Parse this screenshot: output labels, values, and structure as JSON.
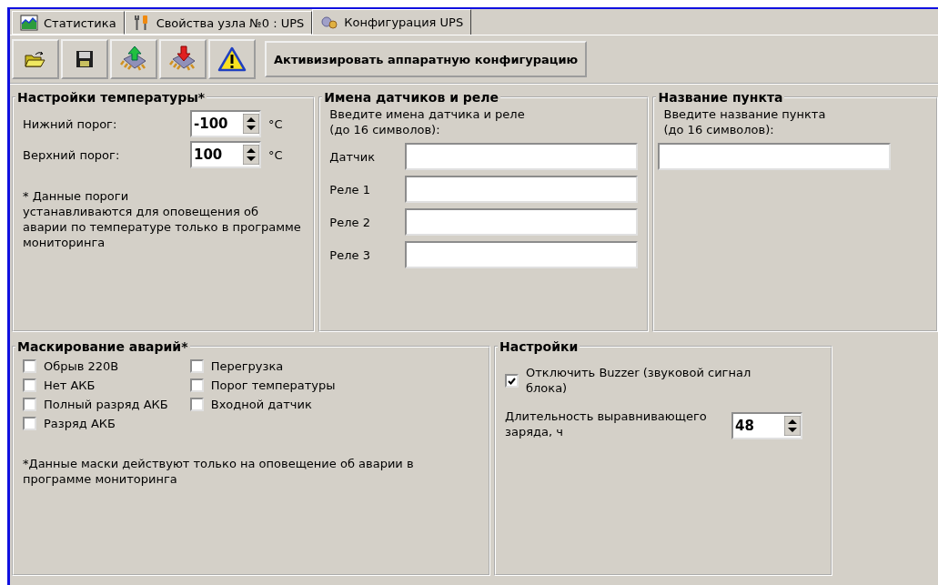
{
  "tabs": [
    {
      "label": "Статистика",
      "kind": "chart",
      "selected": false
    },
    {
      "label": "Свойства узла №0 : UPS",
      "kind": "tools",
      "selected": false
    },
    {
      "label": "Конфигурация UPS",
      "kind": "gears",
      "selected": true
    }
  ],
  "toolbar": {
    "buttons": [
      {
        "kind": "open"
      },
      {
        "kind": "save"
      },
      {
        "kind": "upload"
      },
      {
        "kind": "download"
      },
      {
        "kind": "warning"
      }
    ],
    "action": "Активизировать аппаратную конфигурацию"
  },
  "temperature": {
    "title": "Настройки температуры*",
    "fields": [
      {
        "label": "Нижний порог:",
        "value": "-100",
        "unit": "°C"
      },
      {
        "label": "Верхний порог:",
        "value": "100",
        "unit": "°C"
      }
    ],
    "note": "* Данные пороги\nустанавливаются для оповещения об аварии по температуре только в программе мониторинга"
  },
  "sensors": {
    "title": "Имена датчиков и реле",
    "hint": "Введите имена датчика и реле\n(до 16 символов):",
    "fields": [
      {
        "label": "Датчик"
      },
      {
        "label": "Реле 1"
      },
      {
        "label": "Реле 2"
      },
      {
        "label": "Реле 3"
      }
    ]
  },
  "point": {
    "title": "Название пункта",
    "hint": "Введите название пункта\n(до 16 символов):"
  },
  "masking": {
    "title": "Маскирование аварий*",
    "columns": [
      [
        {
          "label": "Обрыв 220В",
          "checked": false
        },
        {
          "label": "Нет АКБ",
          "checked": false
        },
        {
          "label": "Полный разряд АКБ",
          "checked": false
        },
        {
          "label": "Разряд АКБ",
          "checked": false
        }
      ],
      [
        {
          "label": "Перегрузка",
          "checked": false
        },
        {
          "label": "Порог температуры",
          "checked": false
        },
        {
          "label": "Входной датчик",
          "checked": false
        }
      ]
    ],
    "note": "*Данные маски действуют только на оповещение об аварии в программе мониторинга"
  },
  "settings": {
    "title": "Настройки",
    "buzzer": {
      "label": "Отключить Buzzer (звуковой сигнал блока)",
      "checked": true
    },
    "duration": {
      "label": "Длительность выравнивающего заряда, ч",
      "value": "48"
    }
  }
}
